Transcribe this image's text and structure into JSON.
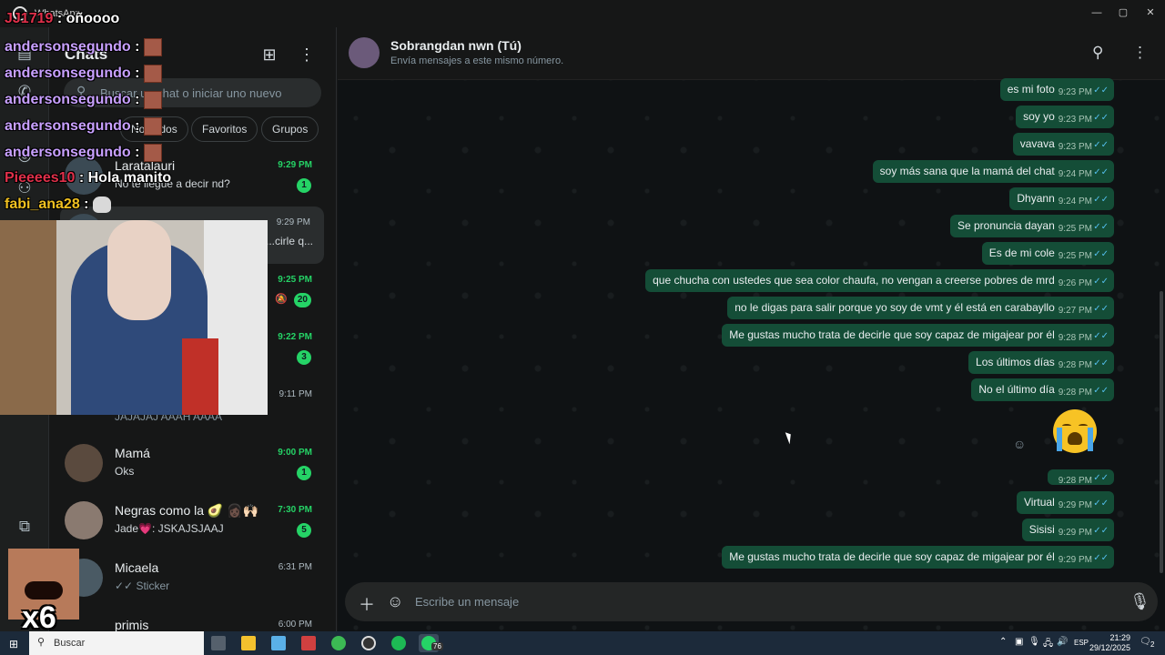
{
  "window": {
    "app_name": "WhatsApp",
    "minimize": "—",
    "maximize": "▢",
    "close": "✕"
  },
  "sidebar": {
    "title": "Chats",
    "search_placeholder": "Buscar un chat o iniciar uno nuevo",
    "filters": [
      "No leídos",
      "Favoritos",
      "Grupos"
    ],
    "chats": [
      {
        "name": "Laratalauri",
        "preview": "No te llegué a decir nd?",
        "time": "9:29 PM",
        "unread": "1",
        "unread_time": true
      },
      {
        "name": "Sobrangdan nwn (Tú)",
        "preview": "...cirle q...",
        "time": "9:29 PM",
        "unread": "",
        "unread_time": false
      },
      {
        "name": "",
        "preview": "",
        "time": "9:25 PM",
        "unread": "20",
        "unread_time": true,
        "muted": true
      },
      {
        "name": "",
        "preview": "",
        "time": "9:22 PM",
        "unread": "3",
        "unread_time": true
      },
      {
        "name": "",
        "preview": "JAJAJAJ AAAH AAAA",
        "time": "9:11 PM",
        "unread": "",
        "unread_time": false
      },
      {
        "name": "Mamá",
        "preview": "Oks",
        "time": "9:00 PM",
        "unread": "1",
        "unread_time": true
      },
      {
        "name": "Negras como la 🥑 👩🏿🙌🏻",
        "preview": "Jade💗: JSKAJSJAAJ",
        "time": "7:30 PM",
        "unread": "5",
        "unread_time": true
      },
      {
        "name": "Micaela",
        "preview": "✓✓ Sticker",
        "time": "6:31 PM",
        "unread": "",
        "unread_time": false
      },
      {
        "name": "primis",
        "preview": "",
        "time": "6:00 PM",
        "unread": "",
        "unread_time": false
      }
    ]
  },
  "chat": {
    "title": "Sobrangdan nwn (Tú)",
    "subtitle": "Envía mensajes a este mismo número.",
    "composer_placeholder": "Escribe un mensaje",
    "messages": [
      {
        "text": "es mi foto",
        "time": "9:23 PM"
      },
      {
        "text": "soy yo",
        "time": "9:23 PM"
      },
      {
        "text": "vavava",
        "time": "9:23 PM"
      },
      {
        "text": "soy más sana que la mamá del chat",
        "time": "9:24 PM"
      },
      {
        "text": "Dhyann",
        "time": "9:24 PM"
      },
      {
        "text": "Se pronuncia dayan",
        "time": "9:25 PM"
      },
      {
        "text": "Es de mi cole",
        "time": "9:25 PM"
      },
      {
        "text": "que chucha con ustedes que sea color chaufa, no vengan a creerse pobres de mrd",
        "time": "9:26 PM"
      },
      {
        "text": "no le digas para salir porque yo soy de vmt y él está en carabayllo",
        "time": "9:27 PM"
      },
      {
        "text": "Me gustas mucho trata de decirle que soy capaz de migajear por él",
        "time": "9:28 PM"
      },
      {
        "text": "Los últimos días",
        "time": "9:28 PM"
      },
      {
        "text": "No el último día",
        "time": "9:28 PM"
      },
      {
        "text": "",
        "time": "9:28 PM"
      },
      {
        "text": "Virtual",
        "time": "9:29 PM"
      },
      {
        "text": "Sisisi",
        "time": "9:29 PM"
      },
      {
        "text": "Me gustas mucho trata de decirle que soy capaz de migajear por él",
        "time": "9:29 PM"
      }
    ]
  },
  "overlay": {
    "lines": [
      {
        "user": "JJ1719",
        "sep": " : ",
        "msg": "oñoooo",
        "color": "#e0304a",
        "emote": false
      },
      {
        "user": "andersonsegundo",
        "sep": " : ",
        "msg": "",
        "color": "#c8a0ff",
        "emote": true
      },
      {
        "user": "andersonsegundo",
        "sep": " : ",
        "msg": "",
        "color": "#c8a0ff",
        "emote": true
      },
      {
        "user": "andersonsegundo",
        "sep": " : ",
        "msg": "",
        "color": "#c8a0ff",
        "emote": true
      },
      {
        "user": "andersonsegundo",
        "sep": " : ",
        "msg": "",
        "color": "#c8a0ff",
        "emote": true
      },
      {
        "user": "andersonsegundo",
        "sep": " : ",
        "msg": "",
        "color": "#c8a0ff",
        "emote": true
      },
      {
        "user": "Pieeees10",
        "sep": " : ",
        "msg": "Hola manito",
        "color": "#e0304a",
        "emote": false
      },
      {
        "user": "fabi_ana28",
        "sep": " : ",
        "msg": "",
        "color": "#f0c020",
        "emote": "cat"
      }
    ],
    "meme_count": "x6"
  },
  "taskbar": {
    "search_label": "Buscar",
    "whatsapp_count": "76",
    "rail_badge": "76",
    "language": "ESP",
    "time": "21:29",
    "date": "29/12/2025",
    "notif": "2"
  }
}
